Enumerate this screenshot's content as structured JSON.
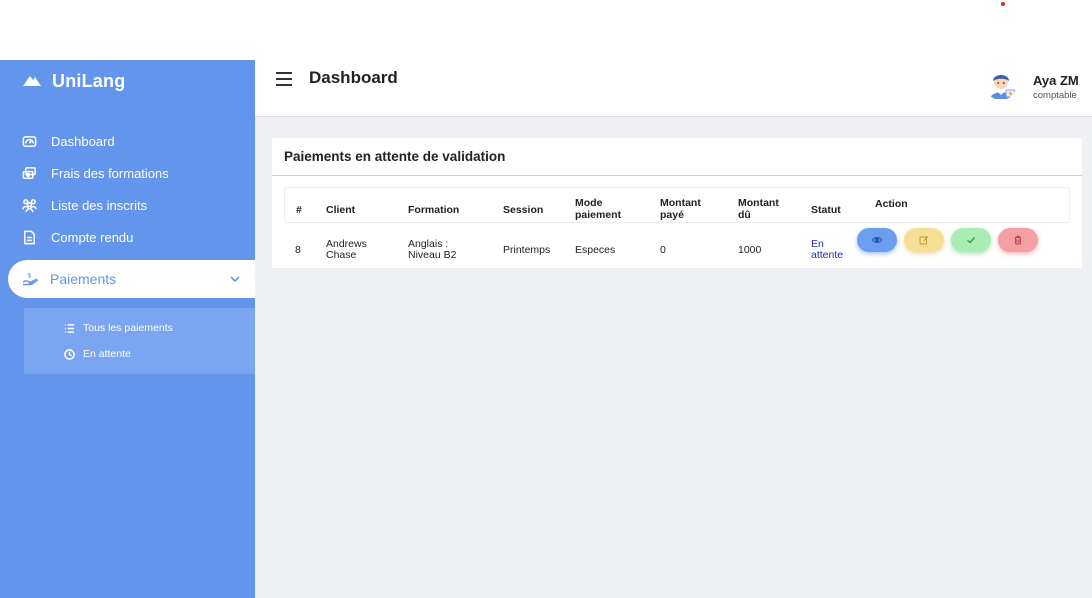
{
  "app": {
    "brand": "UniLang"
  },
  "sidebar": {
    "items": [
      {
        "label": "Dashboard",
        "icon": "dashboard-icon"
      },
      {
        "label": "Frais des formations",
        "icon": "money-icon"
      },
      {
        "label": "Liste des inscrits",
        "icon": "users-icon"
      },
      {
        "label": "Compte rendu",
        "icon": "report-icon"
      }
    ],
    "active": {
      "label": "Paiements",
      "icon": "payment-icon"
    },
    "submenu": [
      {
        "label": "Tous les paiements",
        "icon": "list-icon"
      },
      {
        "label": "En attente",
        "icon": "clock-icon"
      }
    ]
  },
  "header": {
    "title": "Dashboard",
    "user": {
      "name": "Aya ZM",
      "role": "comptable"
    }
  },
  "card": {
    "title": "Paiements en attente de validation",
    "columns": [
      "#",
      "Client",
      "Formation",
      "Session",
      "Mode paiement",
      "Montant payé",
      "Montant dû",
      "Statut",
      "Action"
    ],
    "rows": [
      {
        "id": "8",
        "client": "Andrews Chase",
        "formation": "Anglais : Niveau B2",
        "session": "Printemps",
        "mode": "Especes",
        "paid": "0",
        "due": "1000",
        "status": "En attente"
      }
    ]
  },
  "colors": {
    "sidebar": "#6495ed",
    "status": "#1f2bd1",
    "view": "#6c9ef0",
    "edit": "#f6df94",
    "validate": "#a9ecb4",
    "delete": "#f59ea3"
  }
}
